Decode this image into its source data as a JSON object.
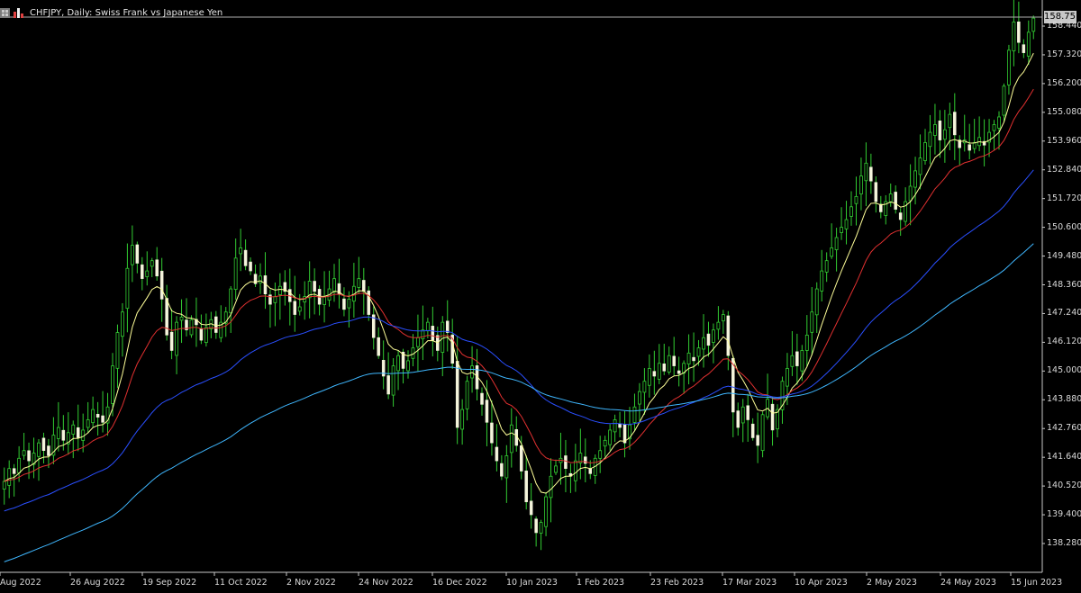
{
  "window": {
    "title": "CHFJPY, Daily:  Swiss Frank vs Japanese Yen",
    "icons": [
      "table-icon",
      "bar-chart-icon"
    ]
  },
  "chart_data": {
    "type": "candlestick",
    "symbol": "CHFJPY",
    "timeframe": "Daily",
    "current_price": "158.751",
    "y_ticks": [
      "158.440",
      "157.320",
      "156.200",
      "155.080",
      "153.960",
      "152.840",
      "151.720",
      "150.600",
      "149.480",
      "148.360",
      "147.240",
      "146.120",
      "145.000",
      "143.880",
      "142.760",
      "141.640",
      "140.520",
      "139.400",
      "138.280"
    ],
    "ylim": [
      137.3,
      159.2
    ],
    "x_ticks": [
      "Aug 2022",
      "26 Aug 2022",
      "19 Sep 2022",
      "11 Oct 2022",
      "2 Nov 2022",
      "24 Nov 2022",
      "16 Dec 2022",
      "10 Jan 2023",
      "1 Feb 2023",
      "23 Feb 2023",
      "17 Mar 2023",
      "10 Apr 2023",
      "2 May 2023",
      "24 May 2023",
      "15 Jun 2023"
    ],
    "closes": [
      140.7,
      141.2,
      141.0,
      141.6,
      141.9,
      141.5,
      141.8,
      142.2,
      141.9,
      141.7,
      142.5,
      142.8,
      142.3,
      142.6,
      142.9,
      142.4,
      142.7,
      143.1,
      143.5,
      143.2,
      143.0,
      143.6,
      145.2,
      146.5,
      147.3,
      149.0,
      149.9,
      149.2,
      148.6,
      148.9,
      149.3,
      148.7,
      147.8,
      146.4,
      145.8,
      146.9,
      147.1,
      146.6,
      147.0,
      146.8,
      146.2,
      146.7,
      147.0,
      146.5,
      146.9,
      147.3,
      148.2,
      149.4,
      149.8,
      149.1,
      148.9,
      148.4,
      148.7,
      148.0,
      147.6,
      147.9,
      148.3,
      148.1,
      147.7,
      147.2,
      147.5,
      147.9,
      148.5,
      148.1,
      147.6,
      147.9,
      148.2,
      148.6,
      148.0,
      147.4,
      147.8,
      148.3,
      148.6,
      148.1,
      147.2,
      146.3,
      145.6,
      144.8,
      144.1,
      145.2,
      145.6,
      145.1,
      145.4,
      145.9,
      146.3,
      146.6,
      146.9,
      146.2,
      145.8,
      146.9,
      146.5,
      145.3,
      142.8,
      143.5,
      144.6,
      145.2,
      144.3,
      143.7,
      143.0,
      142.2,
      141.5,
      140.9,
      141.7,
      142.9,
      142.1,
      141.1,
      139.9,
      139.4,
      138.7,
      139.1,
      140.1,
      140.9,
      141.3,
      141.6,
      141.2,
      140.9,
      141.5,
      141.8,
      141.4,
      141.0,
      141.6,
      141.9,
      142.3,
      142.7,
      143.1,
      142.8,
      142.2,
      142.9,
      143.6,
      144.2,
      144.6,
      145.1,
      144.8,
      145.3,
      145.0,
      145.6,
      145.2,
      144.9,
      145.3,
      145.7,
      145.4,
      145.9,
      146.3,
      146.0,
      146.6,
      146.9,
      147.2,
      145.6,
      143.4,
      142.8,
      143.6,
      143.1,
      142.4,
      142.1,
      143.3,
      143.9,
      142.7,
      143.5,
      144.6,
      145.1,
      145.6,
      145.2,
      145.8,
      146.4,
      147.3,
      148.2,
      148.9,
      149.3,
      149.8,
      150.2,
      150.6,
      150.9,
      151.4,
      151.8,
      152.6,
      153.1,
      152.4,
      151.6,
      151.2,
      151.6,
      151.9,
      151.3,
      150.9,
      151.6,
      152.2,
      152.8,
      153.3,
      153.9,
      154.3,
      154.6,
      154.0,
      154.4,
      155.0,
      154.2,
      153.7,
      154.0,
      153.6,
      153.9,
      154.1,
      153.8,
      154.3,
      154.6,
      154.9,
      156.1,
      157.5,
      158.6,
      157.8,
      157.4,
      158.2,
      158.75
    ]
  }
}
